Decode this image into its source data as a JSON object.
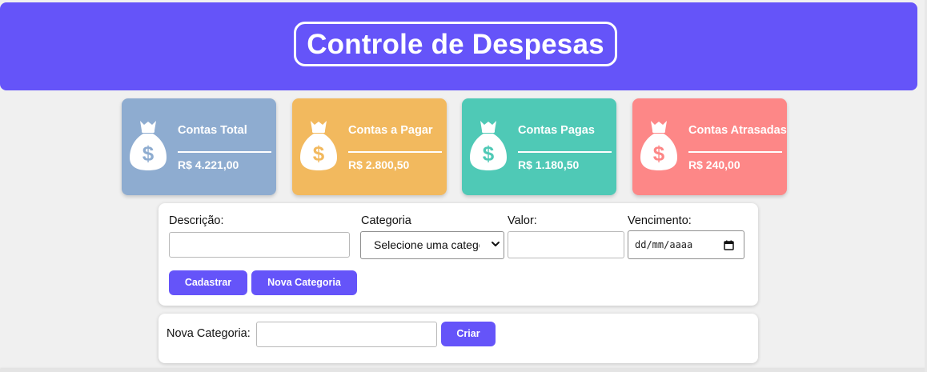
{
  "header": {
    "title": "Controle de Despesas"
  },
  "cards": [
    {
      "label": "Contas Total",
      "amount": "R$ 4.221,00",
      "color": "#8eacd0"
    },
    {
      "label": "Contas a Pagar",
      "amount": "R$ 2.800,50",
      "color": "#f2b95e"
    },
    {
      "label": "Contas Pagas",
      "amount": "R$ 1.180,50",
      "color": "#4fc9b6"
    },
    {
      "label": "Contas Atrasadas",
      "amount": "R$ 240,00",
      "color": "#fd8787"
    }
  ],
  "form": {
    "descricao_label": "Descrição:",
    "descricao_value": "",
    "categoria_label": "Categoria",
    "categoria_selected": "Selecione uma categoria",
    "valor_label": "Valor:",
    "valor_value": "",
    "vencimento_label": "Vencimento:",
    "vencimento_placeholder": "dd/mm/aaaa",
    "cadastrar_label": "Cadastrar",
    "nova_categoria_label": "Nova Categoria"
  },
  "category_form": {
    "label": "Nova Categoria:",
    "input_value": "",
    "criar_label": "Criar"
  },
  "colors": {
    "accent": "#6554f9"
  },
  "icons": {
    "card_icon": "money-bag-icon",
    "select_icon": "chevron-down-icon",
    "date_icon": "calendar-icon"
  }
}
